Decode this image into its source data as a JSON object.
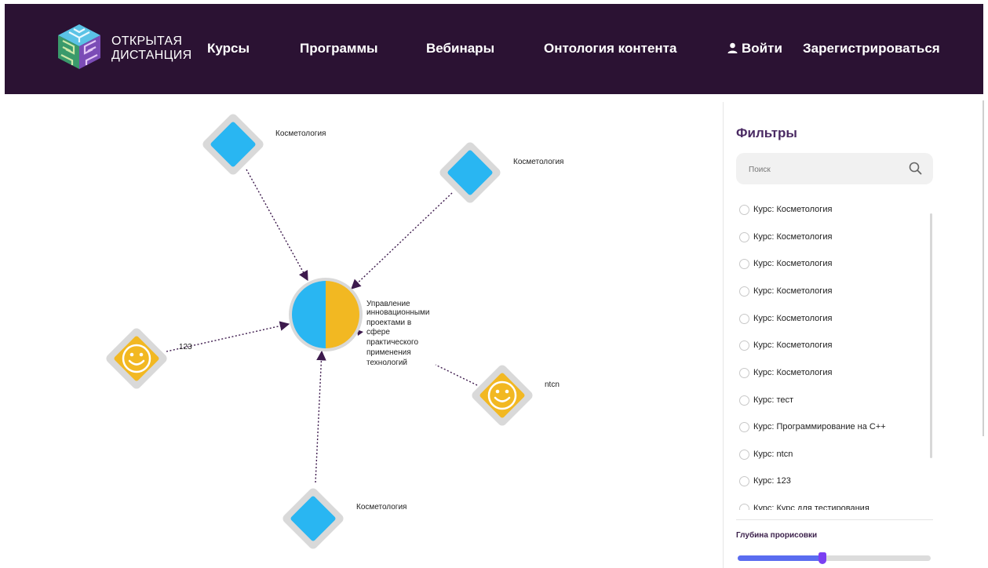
{
  "header": {
    "logo_line1": "ОТКРЫТАЯ",
    "logo_line2": "ДИСТАНЦИЯ",
    "nav": [
      "Курсы",
      "Программы",
      "Вебинары",
      "Онтология контента"
    ],
    "login_label": "Войти",
    "register_label": "Зарегистрироваться",
    "bg_color": "#2b1233"
  },
  "graph": {
    "center_label": [
      "Управление",
      "инновационными",
      "проектами в",
      "сфере",
      "практического",
      "применения",
      "технологий"
    ],
    "nodes": [
      {
        "label": "Косметология",
        "kind": "diamond-blue"
      },
      {
        "label": "Косметология",
        "kind": "diamond-blue"
      },
      {
        "label": "123",
        "kind": "diamond-smiley"
      },
      {
        "label": "ntcn",
        "kind": "diamond-smiley"
      },
      {
        "label": "Косметология",
        "kind": "diamond-blue"
      }
    ],
    "colors": {
      "blue": "#29b6f2",
      "yellow": "#f2b822",
      "edge": "#3d1a4d",
      "ring": "#d9d9d9"
    }
  },
  "filters": {
    "title": "Фильтры",
    "search_placeholder": "Поиск",
    "items": [
      "Курс: Косметология",
      "Курс: Косметология",
      "Курс: Косметология",
      "Курс: Косметология",
      "Курс: Косметология",
      "Курс: Косметология",
      "Курс: Косметология",
      "Курс: тест",
      "Курс: Программирование на C++",
      "Курс: ntcn",
      "Курс: 123",
      "Курс: Курс для тестирования"
    ],
    "depth_label": "Глубина прорисовки",
    "depth_value": 0.44
  }
}
